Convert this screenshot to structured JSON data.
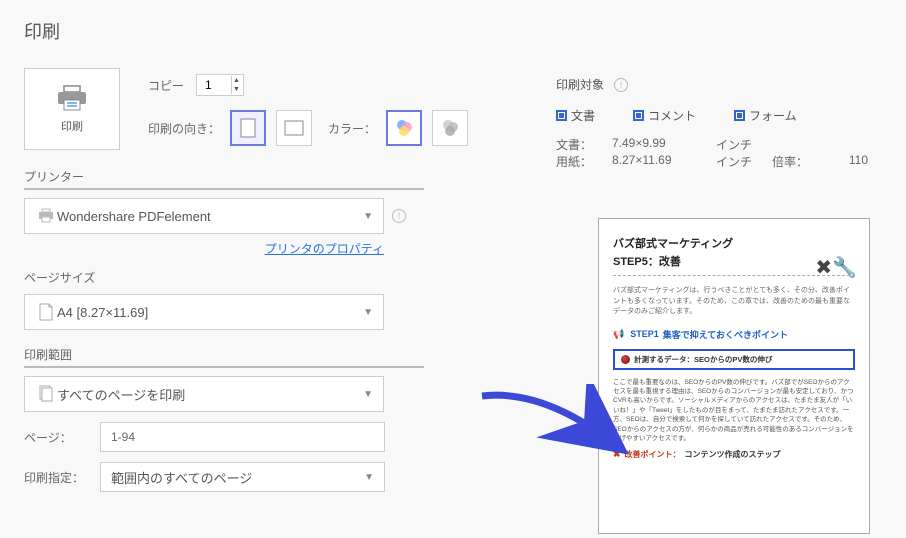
{
  "title": "印刷",
  "tile": {
    "label": "印刷"
  },
  "copy": {
    "label": "コピー",
    "value": "1"
  },
  "orientation": {
    "label": "印刷の向き："
  },
  "color": {
    "label": "カラー："
  },
  "target": {
    "label": "印刷対象"
  },
  "checks": {
    "doc": "文書",
    "comment": "コメント",
    "form": "フォーム"
  },
  "dims": {
    "docLabel": "文書：",
    "doc": "7.49×9.99",
    "unit1": "インチ",
    "paperLabel": "用紙：",
    "paper": "8.27×11.69",
    "unit2": "インチ",
    "ratioLabel": "倍率：",
    "ratio": "110"
  },
  "printer": {
    "label": "プリンター",
    "value": "Wondershare PDFelement",
    "propsLink": "プリンタのプロパティ"
  },
  "pageSize": {
    "label": "ページサイズ",
    "value": "A4 [8.27×11.69]"
  },
  "range": {
    "label": "印刷範囲",
    "value": "すべてのページを印刷"
  },
  "pages": {
    "label": "ページ：",
    "value": "1-94"
  },
  "spec": {
    "label": "印刷指定：",
    "value": "範囲内のすべてのページ"
  },
  "preview": {
    "h1": "バズ部式マーケティング",
    "h2": "STEP5：改善",
    "intro": "バズ部式マーケティングは、行うべきことがとても多く、その分、改善ポイントも多くなっています。そのため、この章では、改善のための最も重要なデータのみご紹介します。",
    "step1Label": "STEP1",
    "step1Text": "集客で抑えておくべきポイント",
    "boxed": "計測するデータ：SEOからのPV数の伸び",
    "para": "ここで最も重要なのは、SEOからのPV数の伸びです。バズ部でがSEOからのアクセスを最も重視する理由は、SEOからのコンバージョンが最も安定しており、かつCVRも高いからです。ソーシャルメディアからのアクセスは、たまたま友人が「いいね！」や「Tweet」をしたものが目をまって、たまたま訪れたアクセスです。一方、SEOは、自分で検索して何かを探していて訪れたアクセスです。そのため、SEOからのアクセスの方が、何らかの商品が売れる可能性のあるコンバージョンを上げやすいアクセスです。",
    "step2Pre": "改善ポイント：",
    "step2Text": "コンテンツ作成のステップ"
  }
}
